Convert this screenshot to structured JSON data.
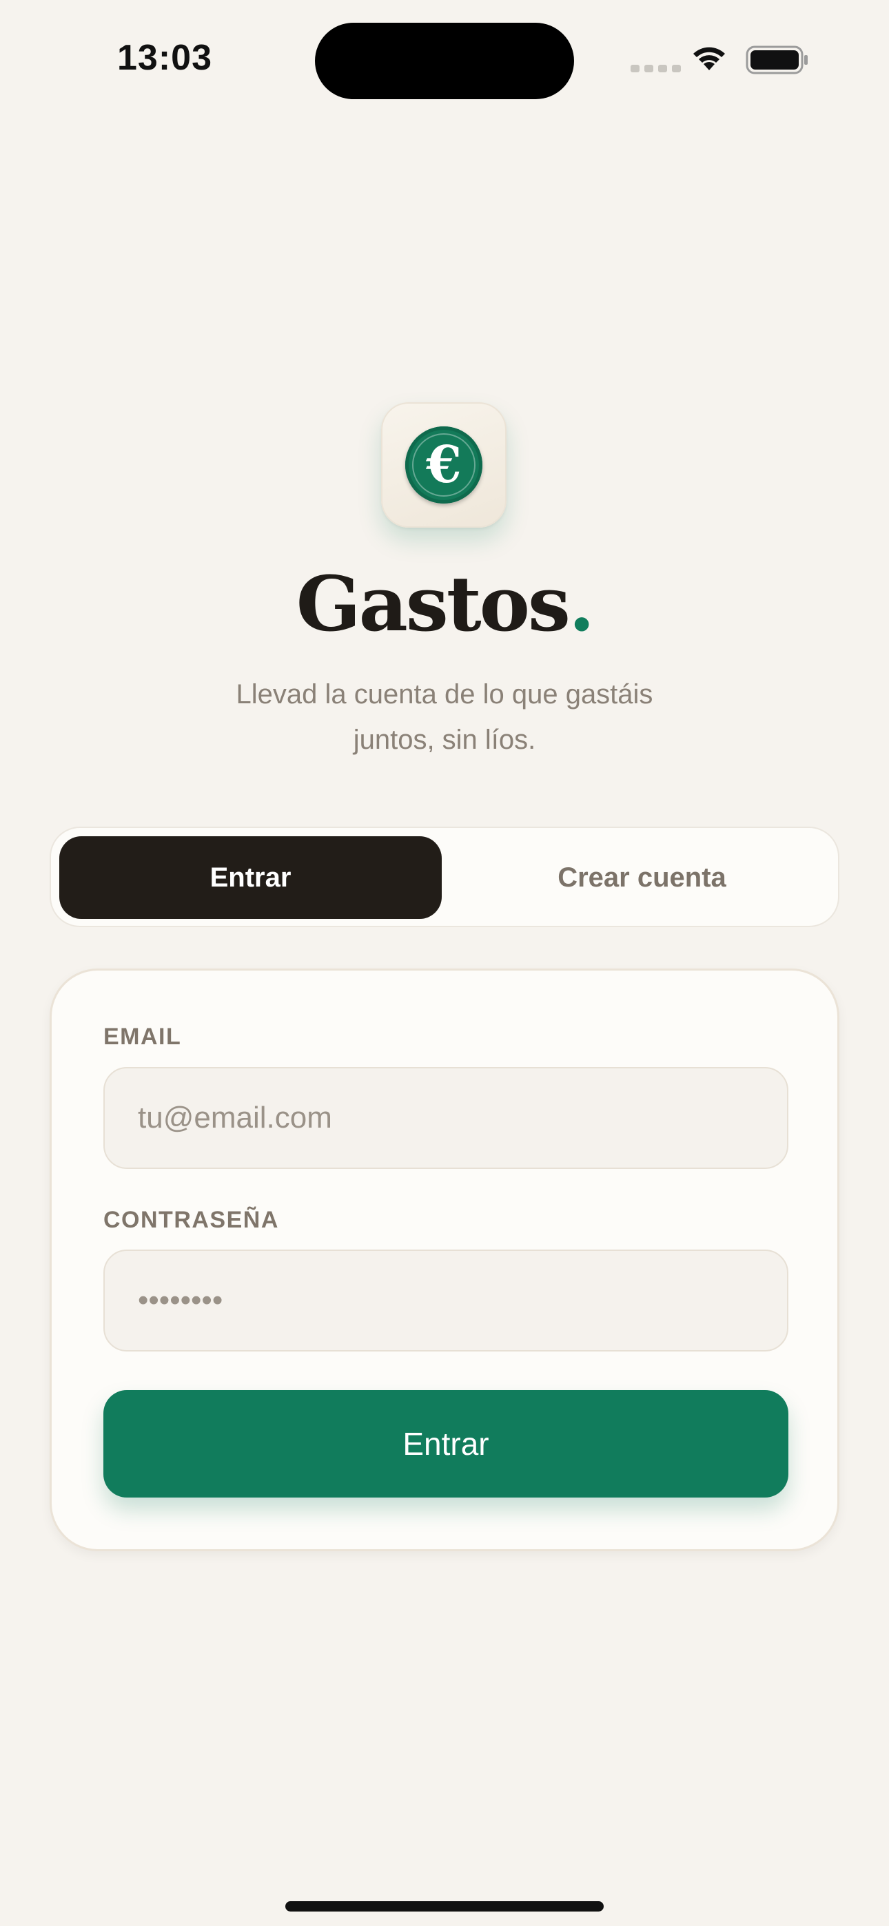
{
  "status_bar": {
    "time": "13:03",
    "icons": [
      "cellular-signal-icon",
      "wifi-icon",
      "battery-icon"
    ]
  },
  "app": {
    "icon": "euro-coin-icon",
    "icon_glyph": "€",
    "title": "Gastos",
    "title_accent": ".",
    "subtitle_line1": "Llevad la cuenta de lo que gastáis",
    "subtitle_line2": "juntos, sin líos."
  },
  "auth_tabs": {
    "login_label": "Entrar",
    "signup_label": "Crear cuenta",
    "selected": "Entrar"
  },
  "form": {
    "email_label": "EMAIL",
    "email_placeholder": "tu@email.com",
    "email_value": "",
    "password_label": "CONTRASEÑA",
    "password_placeholder": "••••••••",
    "password_value": "",
    "submit_label": "Entrar"
  },
  "colors": {
    "background": "#f6f3ee",
    "accent": "#117c5c",
    "dark": "#221d18",
    "muted_text": "#8a8177"
  }
}
